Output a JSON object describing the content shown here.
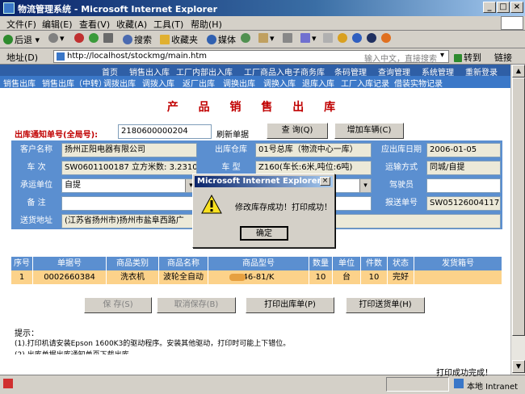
{
  "window": {
    "title": "物流管理系统 - Microsoft Internet Explorer",
    "min": "_",
    "max": "□",
    "close": "×"
  },
  "menu": [
    "文件(F)",
    "编辑(E)",
    "查看(V)",
    "收藏(A)",
    "工具(T)",
    "帮助(H)"
  ],
  "toolbar": {
    "back": "后退",
    "search": "搜索",
    "favorites": "收藏夹",
    "media": "媒体"
  },
  "address": {
    "label": "地址(D)",
    "url": "http://localhost/stockmg/main.htm",
    "search_hint": "输入中文，直接搜索",
    "go": "转到",
    "links": "链接"
  },
  "topnav": [
    "首页",
    "销售出入库",
    "工厂内部出入库",
    "工厂商品入电子商务库",
    "条码管理",
    "查询管理",
    "系统管理",
    "重新登录"
  ],
  "subnav": [
    "销售出库",
    "销售出库（中转）",
    "调拨出库",
    "调拨入库",
    "返厂出库",
    "调换出库",
    "调换入库",
    "退库入库",
    "工厂入库记录",
    "借装实物记录"
  ],
  "page": {
    "title": "产 品 销 售 出 库",
    "notice_label": "出库通知单号(全局号):",
    "notice_value": "2180600000204",
    "refresh_text": "刷新单据",
    "query_btn": "查 询(Q)",
    "add_car_btn": "增加车辆(C)"
  },
  "form": {
    "customer_name_label": "客户名称",
    "customer_name": "扬州正阳电器有限公司",
    "out_warehouse_label": "出库仓库",
    "out_warehouse": "01号总库（物流中心一库）",
    "date_label": "应出库日期",
    "date": "2006-01-05",
    "train_label": "车 次",
    "train": "SW0601100187 立方米数: 3.2310",
    "car_type_label": "车 型",
    "car_type": "Z160(车长:6米,吨位:6吨)",
    "transport_label": "运输方式",
    "transport": "同城/自提",
    "carrier_label": "承运单位",
    "carrier": "自提",
    "driver_label": "驾驶员",
    "driver": "",
    "remark_label": "备 注",
    "remark": "",
    "report_no_label": "报送单号",
    "report_no": "SW05126004117",
    "address_label": "送货地址",
    "address": "(江苏省扬州市)扬州市盐阜西路广"
  },
  "table": {
    "headers": [
      "序号",
      "单据号",
      "商品类别",
      "商品名称",
      "商品型号",
      "数量",
      "单位",
      "件数",
      "状态",
      "发货箱号"
    ],
    "rows": [
      [
        "1",
        "0002660384",
        "洗衣机",
        "波轮全自动",
        "46-81/K",
        "10",
        "台",
        "10",
        "完好",
        ""
      ]
    ]
  },
  "actions": {
    "save": "保 存(S)",
    "cancel_save": "取消保存(B)",
    "print_out": "打印出库单(P)",
    "print_delivery": "打印送货单(H)"
  },
  "tips": {
    "title": "提示：",
    "line1": "(1).打印机请安装Epson 1600K3的驱动程序。安装其他驱动，打印时可能上下错位。",
    "line2": "(2).出库单据出库通知单页下载出库。"
  },
  "dialog": {
    "title": "Microsoft Internet Explorer",
    "message": "修改库存成功！打印成功！",
    "ok": "确定"
  },
  "status": {
    "print_done": "打印成功完成！",
    "zone": "本地 Intranet"
  }
}
